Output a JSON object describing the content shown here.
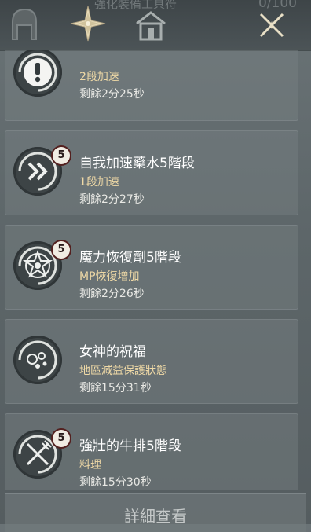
{
  "header": {
    "title": "強化裝備工具符",
    "count": "0/100"
  },
  "buffs": [
    {
      "name": "",
      "stage_badge": "",
      "effect": "2段加速",
      "remaining": "剩餘2分25秒",
      "icon": "exclamation-icon"
    },
    {
      "name": "自我加速藥水5階段",
      "stage_badge": "5",
      "effect": "1段加速",
      "remaining": "剩餘2分27秒",
      "icon": "double-chevron-icon"
    },
    {
      "name": "魔力恢復劑5階段",
      "stage_badge": "5",
      "effect": "MP恢復增加",
      "remaining": "剩餘2分26秒",
      "icon": "mana-star-icon"
    },
    {
      "name": "女神的祝福",
      "stage_badge": "",
      "effect": "地區減益保護狀態",
      "remaining": "剩餘15分31秒",
      "icon": "bubbles-icon"
    },
    {
      "name": "強壯的牛排5階段",
      "stage_badge": "5",
      "effect": "料理",
      "remaining": "剩餘15分30秒",
      "icon": "fork-knife-icon"
    }
  ],
  "footer": {
    "details_label": "詳細查看"
  }
}
